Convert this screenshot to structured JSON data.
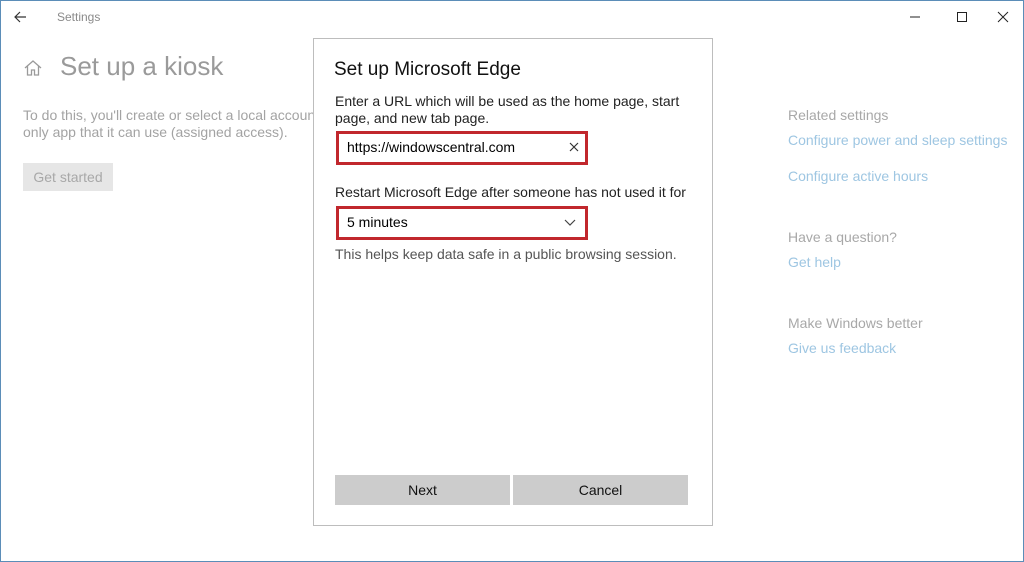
{
  "window": {
    "app_title": "Settings",
    "icons": {
      "back": "back-arrow-icon",
      "minimize": "minimize-icon",
      "maximize": "maximize-icon",
      "close": "close-icon"
    }
  },
  "page": {
    "title": "Set up a kiosk",
    "home_icon": "home-icon",
    "description_lines": [
      "To do this, you'll create or select a local account an",
      "only app that it can use (assigned access)."
    ],
    "get_started_label": "Get started"
  },
  "sidebar": {
    "related_heading": "Related settings",
    "related_links": [
      "Configure power and sleep settings",
      "Configure active hours"
    ],
    "question_heading": "Have a question?",
    "help_link": "Get help",
    "better_heading": "Make Windows better",
    "feedback_link": "Give us feedback"
  },
  "dialog": {
    "title": "Set up Microsoft Edge",
    "url_prompt": "Enter a URL which will be used as the home page, start page, and new tab page.",
    "url_value": "https://windowscentral.com",
    "restart_label": "Restart Microsoft Edge after someone has not used it for",
    "restart_value": "5 minutes",
    "helper_text": "This helps keep data safe in a public browsing session.",
    "next_label": "Next",
    "cancel_label": "Cancel"
  },
  "colors": {
    "highlight": "#c1272d",
    "link": "#9ec6e2",
    "button": "#cccccc"
  }
}
